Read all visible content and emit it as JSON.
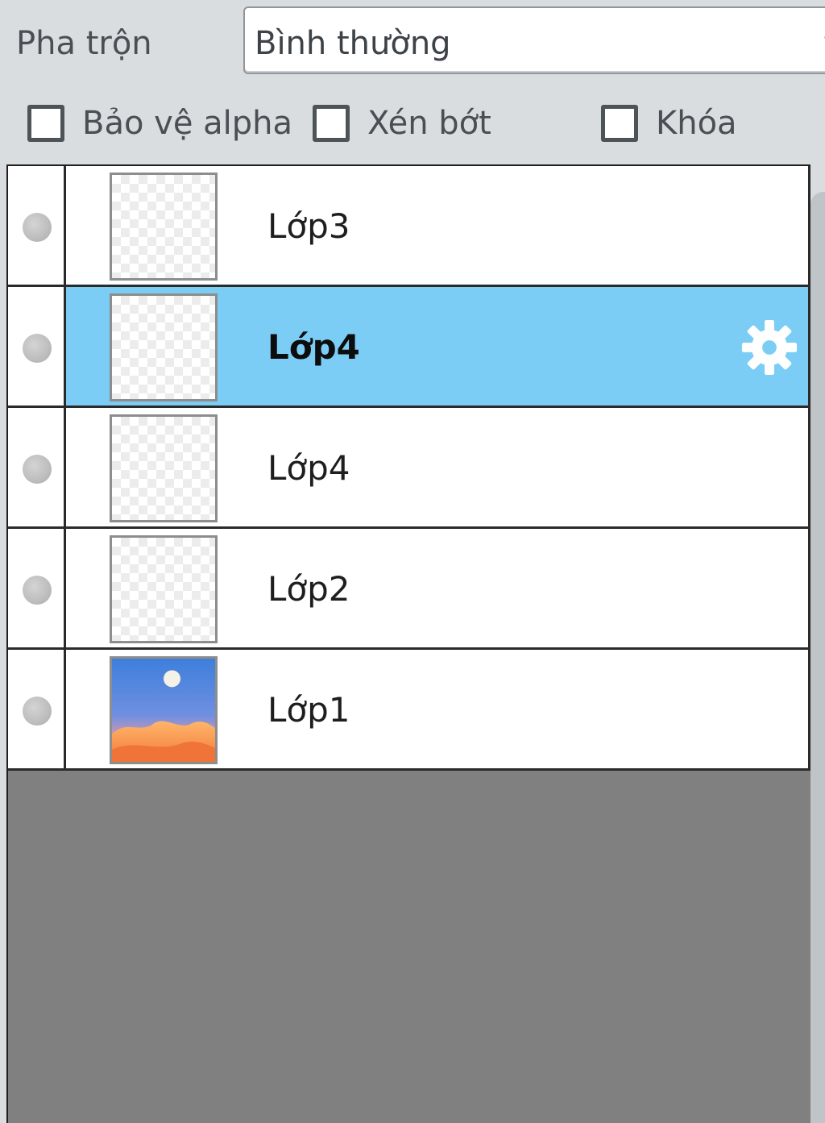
{
  "blend": {
    "label": "Pha trộn",
    "value": "Bình thường",
    "dropdown_icon": "chevron-down-icon"
  },
  "options": {
    "protect_alpha": {
      "label": "Bảo vệ alpha",
      "checked": false
    },
    "clipping": {
      "label": "Xén bớt",
      "checked": false
    },
    "lock": {
      "label": "Khóa",
      "checked": false
    }
  },
  "layers": [
    {
      "name": "Lớp3",
      "selected": false,
      "thumbnail": "transparent"
    },
    {
      "name": "Lớp4",
      "selected": true,
      "thumbnail": "transparent",
      "settings_icon": "gear-icon"
    },
    {
      "name": "Lớp4",
      "selected": false,
      "thumbnail": "transparent"
    },
    {
      "name": "Lớp2",
      "selected": false,
      "thumbnail": "transparent"
    },
    {
      "name": "Lớp1",
      "selected": false,
      "thumbnail": "landscape-image"
    }
  ],
  "colors": {
    "selection": "#7ccdf5",
    "panel_background": "#d9dde0",
    "empty_area": "#808080"
  }
}
